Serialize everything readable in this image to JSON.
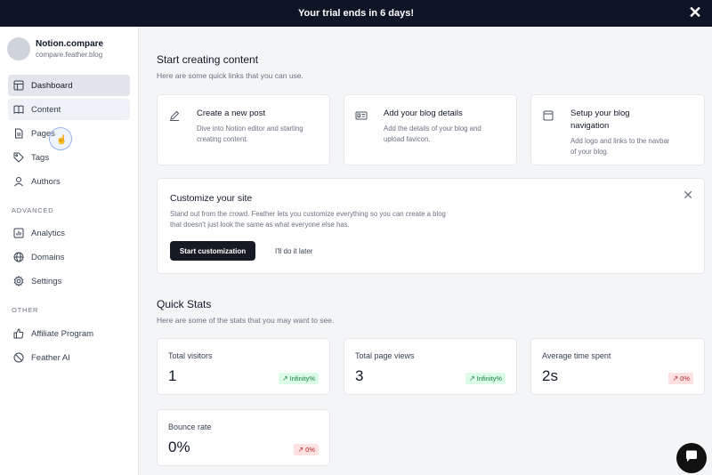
{
  "trial_banner": {
    "text": "Your trial ends in 6 days!",
    "close_glyph": "✕"
  },
  "profile": {
    "name": "Notion.compare",
    "domain": "compare.feather.blog"
  },
  "nav": {
    "dashboard": "Dashboard",
    "content": "Content",
    "pages": "Pages",
    "tags": "Tags",
    "authors": "Authors",
    "advanced_label": "ADVANCED",
    "analytics": "Analytics",
    "domains": "Domains",
    "settings": "Settings",
    "other_label": "OTHER",
    "affiliate": "Affiliate Program",
    "feather_ai": "Feather AI"
  },
  "start": {
    "title": "Start creating content",
    "subtitle": "Here are some quick links that you can use.",
    "cards": [
      {
        "title": "Create a new post",
        "desc": "Dive into Notion editor and starting creating content.",
        "icon": "pencil-icon"
      },
      {
        "title": "Add your blog details",
        "desc": "Add the details of your blog and upload favicon.",
        "icon": "id-card-icon"
      },
      {
        "title": "Setup your blog navigation",
        "desc": "Add logo and links to the navbar of your blog.",
        "icon": "layout-icon"
      }
    ]
  },
  "customize": {
    "title": "Customize your site",
    "desc": "Stand out from the crowd. Feather lets you customize everything so you can create a blog that doesn't just look the same as what everyone else has.",
    "primary_button": "Start customization",
    "secondary_button": "I'll do it later",
    "close_glyph": "✕"
  },
  "stats": {
    "title": "Quick Stats",
    "subtitle": "Here are some of the stats that you may want to see.",
    "items": [
      {
        "label": "Total visitors",
        "value": "1",
        "badge": "Infinity%",
        "trend": "green"
      },
      {
        "label": "Total page views",
        "value": "3",
        "badge": "Infinity%",
        "trend": "green"
      },
      {
        "label": "Average time spent",
        "value": "2s",
        "badge": "0%",
        "trend": "red"
      },
      {
        "label": "Bounce rate",
        "value": "0%",
        "badge": "0%",
        "trend": "red"
      }
    ],
    "trend_glyph": "↗"
  },
  "colors": {
    "banner": "#0e1526",
    "active_nav": "#e2e6ec",
    "primary_button": "#151a25",
    "badge_green": "#dcfce7",
    "badge_red": "#fee2e2"
  }
}
